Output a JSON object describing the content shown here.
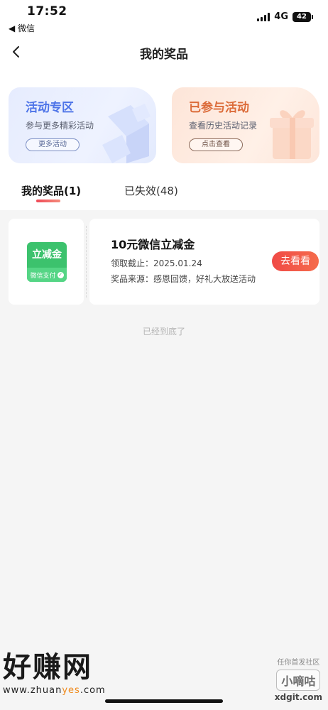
{
  "status_bar": {
    "time": "17:52",
    "back_app": "◀ 微信",
    "network": "4G",
    "battery": "42"
  },
  "nav": {
    "title": "我的奖品"
  },
  "promo_cards": [
    {
      "title": "活动专区",
      "subtitle": "参与更多精彩活动",
      "button": "更多活动",
      "accent": "#4e74e8"
    },
    {
      "title": "已参与活动",
      "subtitle": "查看历史活动记录",
      "button": "点击查看",
      "accent": "#dc6c3a"
    }
  ],
  "tabs": [
    {
      "label": "我的奖品(1)",
      "active": true
    },
    {
      "label": "已失效(48)",
      "active": false
    }
  ],
  "coupons": [
    {
      "badge_top": "立减金",
      "badge_bottom": "微信支付",
      "title": "10元微信立减金",
      "deadline": "领取截止：2025.01.24",
      "source": "奖品来源：感恩回馈，好礼大放送活动",
      "button": "去看看",
      "badge_color": "#3cc26d",
      "button_color": "#f04a46"
    }
  ],
  "end_text": "已经到底了",
  "watermarks": {
    "left_main": "好赚网",
    "left_url_prefix": "www.zhuan",
    "left_url_accent": "yes",
    "left_url_suffix": ".com",
    "right_small": "任你首发社区",
    "right_main": "小嘀咕",
    "right_url": "xdgit.com"
  }
}
